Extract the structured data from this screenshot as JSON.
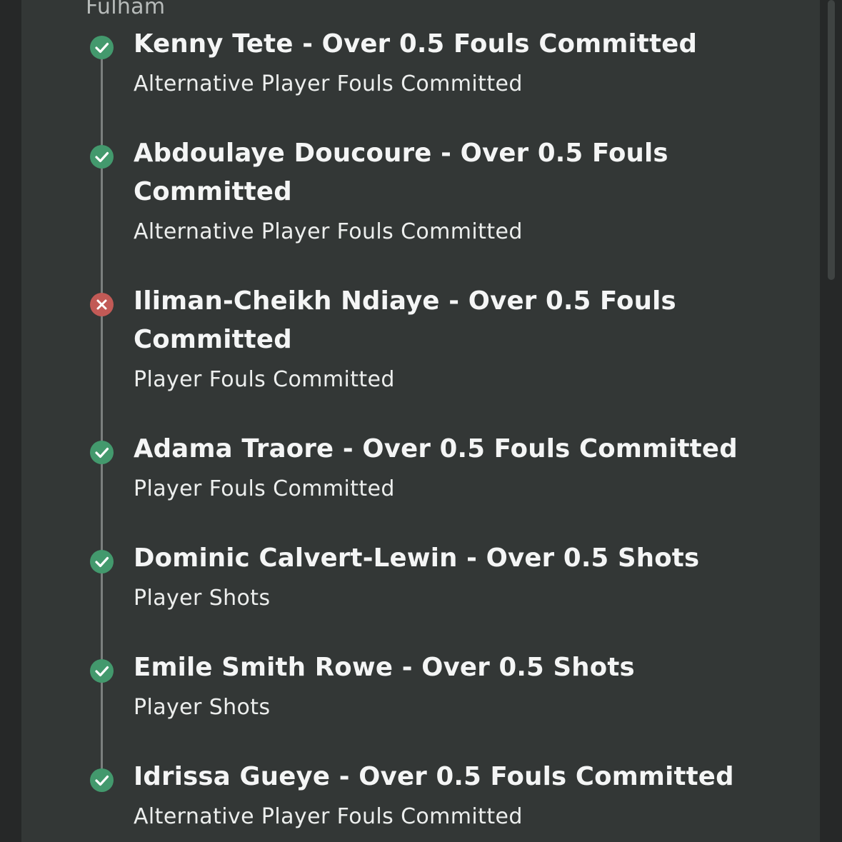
{
  "header": {
    "team": "Fulham"
  },
  "colors": {
    "won": "#43996d",
    "lost": "#c25a56",
    "panel": "#333736"
  },
  "legs": [
    {
      "selection": "Kenny Tete - Over 0.5 Fouls Committed",
      "market": "Alternative Player Fouls Committed",
      "status": "won",
      "status_icon": "check-icon"
    },
    {
      "selection": "Abdoulaye Doucoure - Over 0.5 Fouls Committed",
      "market": "Alternative Player Fouls Committed",
      "status": "won",
      "status_icon": "check-icon"
    },
    {
      "selection": "Iliman-Cheikh Ndiaye - Over 0.5 Fouls Committed",
      "market": "Player Fouls Committed",
      "status": "lost",
      "status_icon": "cross-icon"
    },
    {
      "selection": "Adama Traore - Over 0.5 Fouls Committed",
      "market": "Player Fouls Committed",
      "status": "won",
      "status_icon": "check-icon"
    },
    {
      "selection": "Dominic Calvert-Lewin - Over 0.5 Shots",
      "market": "Player Shots",
      "status": "won",
      "status_icon": "check-icon"
    },
    {
      "selection": "Emile Smith Rowe - Over 0.5 Shots",
      "market": "Player Shots",
      "status": "won",
      "status_icon": "check-icon"
    },
    {
      "selection": "Idrissa Gueye - Over 0.5 Fouls Committed",
      "market": "Alternative Player Fouls Committed",
      "status": "won",
      "status_icon": "check-icon"
    }
  ]
}
